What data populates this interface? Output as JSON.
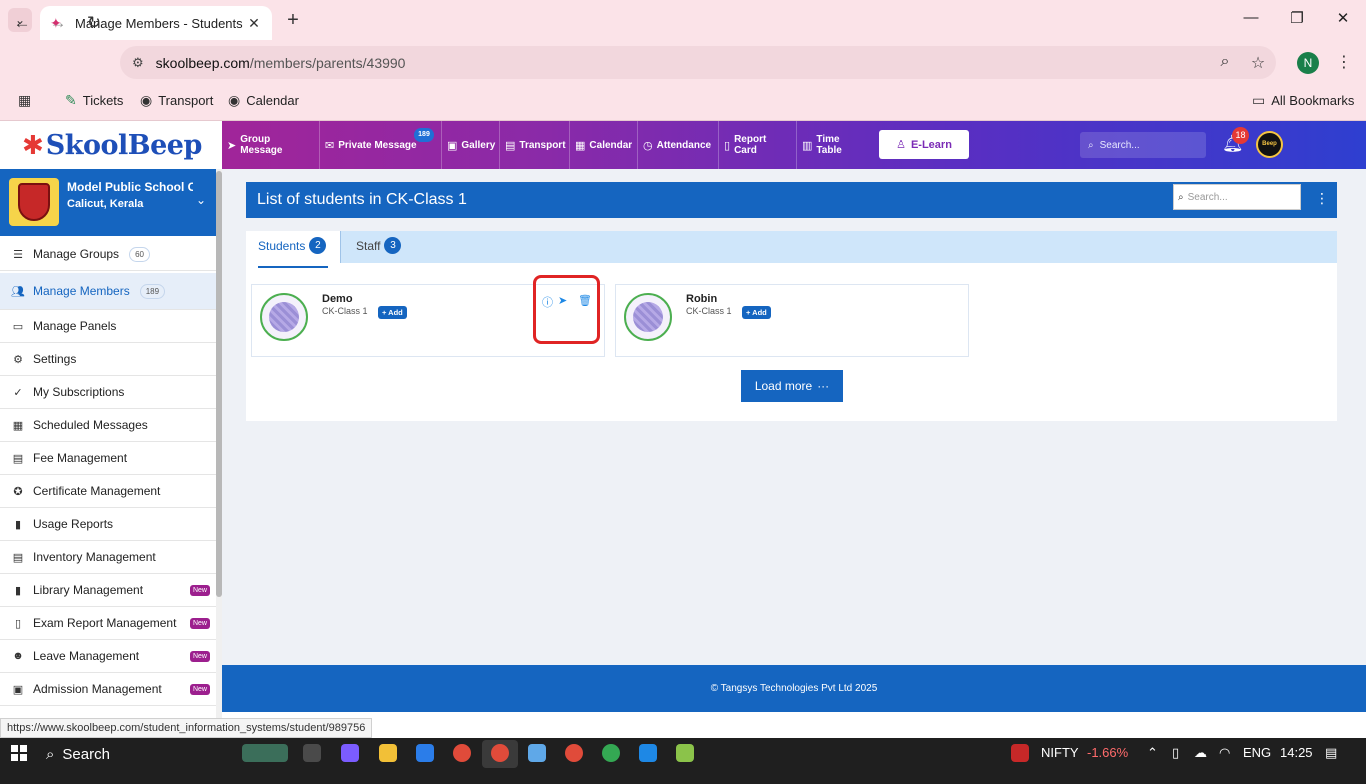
{
  "browser": {
    "tab_title": "Manage Members - Students",
    "url_host": "skoolbeep.com",
    "url_path": "/members/parents/43990",
    "profile_initial": "N",
    "bookmarks": [
      "Tickets",
      "Transport",
      "Calendar"
    ],
    "all_bookmarks": "All Bookmarks"
  },
  "header": {
    "logo_text": "SkoolBeep",
    "nav": [
      "Group Message",
      "Private Message",
      "Gallery",
      "Transport",
      "Calendar",
      "Attendance",
      "Report Card",
      "Time Table"
    ],
    "private_message_badge": "189",
    "elearn_label": "E-Learn",
    "search_placeholder": "Search...",
    "notification_count": "18",
    "avatar_text": "Beep"
  },
  "sidebar": {
    "school_name": "Model Public School C",
    "school_location": "Calicut, Kerala",
    "items": [
      {
        "label": "Manage Groups",
        "count": "60",
        "icon": "list-icon"
      },
      {
        "label": "Manage Members",
        "count": "189",
        "icon": "users-icon"
      },
      {
        "label": "Manage Panels",
        "icon": "monitor-icon"
      },
      {
        "label": "Settings",
        "icon": "gear-icon"
      },
      {
        "label": "My Subscriptions",
        "icon": "check-icon"
      },
      {
        "label": "Scheduled Messages",
        "icon": "calendar-icon"
      },
      {
        "label": "Fee Management",
        "icon": "document-icon"
      },
      {
        "label": "Certificate Management",
        "icon": "certificate-icon"
      },
      {
        "label": "Usage Reports",
        "icon": "bar-chart-icon"
      },
      {
        "label": "Inventory Management",
        "icon": "table-icon"
      },
      {
        "label": "Library Management",
        "badge": "New",
        "icon": "book-icon"
      },
      {
        "label": "Exam Report Management",
        "badge": "New",
        "icon": "report-icon"
      },
      {
        "label": "Leave Management",
        "badge": "New",
        "icon": "person-icon"
      },
      {
        "label": "Admission Management",
        "badge": "New",
        "icon": "id-card-icon"
      }
    ]
  },
  "main": {
    "title": "List of students in CK-Class 1",
    "search_placeholder": "Search...",
    "tabs": [
      {
        "label": "Students",
        "count": "2"
      },
      {
        "label": "Staff",
        "count": "3"
      }
    ],
    "members": [
      {
        "name": "Demo",
        "class": "CK-Class 1",
        "add_label": "+ Add"
      },
      {
        "name": "Robin",
        "class": "CK-Class 1",
        "add_label": "+ Add"
      }
    ],
    "load_more_label": "Load more"
  },
  "footer": {
    "text": "© Tangsys Technologies Pvt Ltd 2025"
  },
  "statusbar": {
    "url": "https://www.skoolbeep.com/student_information_systems/student/989756"
  },
  "taskbar": {
    "search_label": "Search",
    "nifty_label": "NIFTY",
    "nifty_change": "-1.66%",
    "language": "ENG",
    "time": "14:25"
  },
  "colors": {
    "primary": "#1565c0",
    "header_start": "#b0218f",
    "header_end": "#2e3fd0",
    "new_badge": "#9c1f8e",
    "highlight": "#e02424"
  }
}
